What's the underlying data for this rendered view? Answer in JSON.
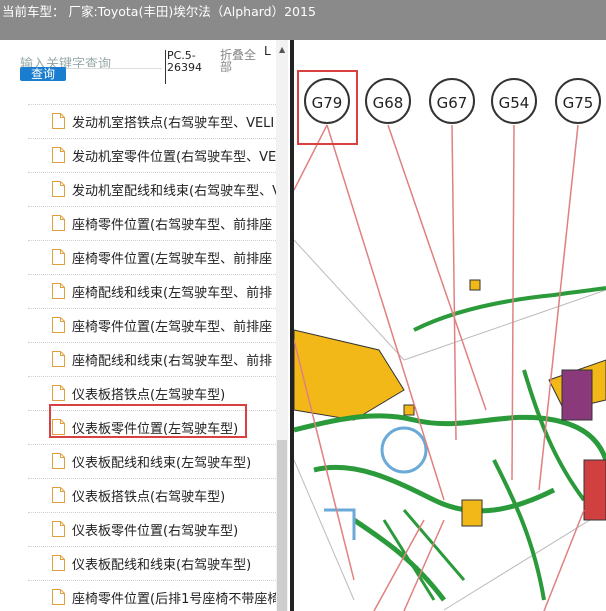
{
  "header": {
    "title": "当前车型： 厂家:Toyota(丰田)埃尔法（Alphard）2015"
  },
  "search": {
    "placeholder": "输入关键字查询",
    "button_label": "查询"
  },
  "doc_id": {
    "line1": "PC.5-",
    "line2": "26394"
  },
  "fold_all": {
    "line1": "折叠全",
    "line2": "部"
  },
  "cut_text": "L",
  "tree": {
    "items": [
      "发动机室搭铁点(右驾驶车型、VELI",
      "发动机室零件位置(右驾驶车型、VE",
      "发动机室配线和线束(右驾驶车型、V",
      "座椅零件位置(右驾驶车型、前排座",
      "座椅零件位置(左驾驶车型、前排座",
      "座椅配线和线束(左驾驶车型、前排",
      "座椅零件位置(左驾驶车型、前排座",
      "座椅配线和线束(右驾驶车型、前排",
      "仪表板搭铁点(左驾驶车型)",
      "仪表板零件位置(左驾驶车型)",
      "仪表板配线和线束(左驾驶车型)",
      "仪表板搭铁点(右驾驶车型)",
      "仪表板零件位置(右驾驶车型)",
      "仪表板配线和线束(右驾驶车型)",
      "座椅零件位置(后排1号座椅不带座椅"
    ],
    "selected_index": 9
  },
  "diagram": {
    "connectors": [
      "G79",
      "G68",
      "G67",
      "G54",
      "G75"
    ],
    "highlighted": "G79"
  },
  "colors": {
    "highlight": "#d94040",
    "query_button": "#1a7dd0",
    "harness_green": "#2a9a3a",
    "panel_yellow": "#f2b817"
  }
}
